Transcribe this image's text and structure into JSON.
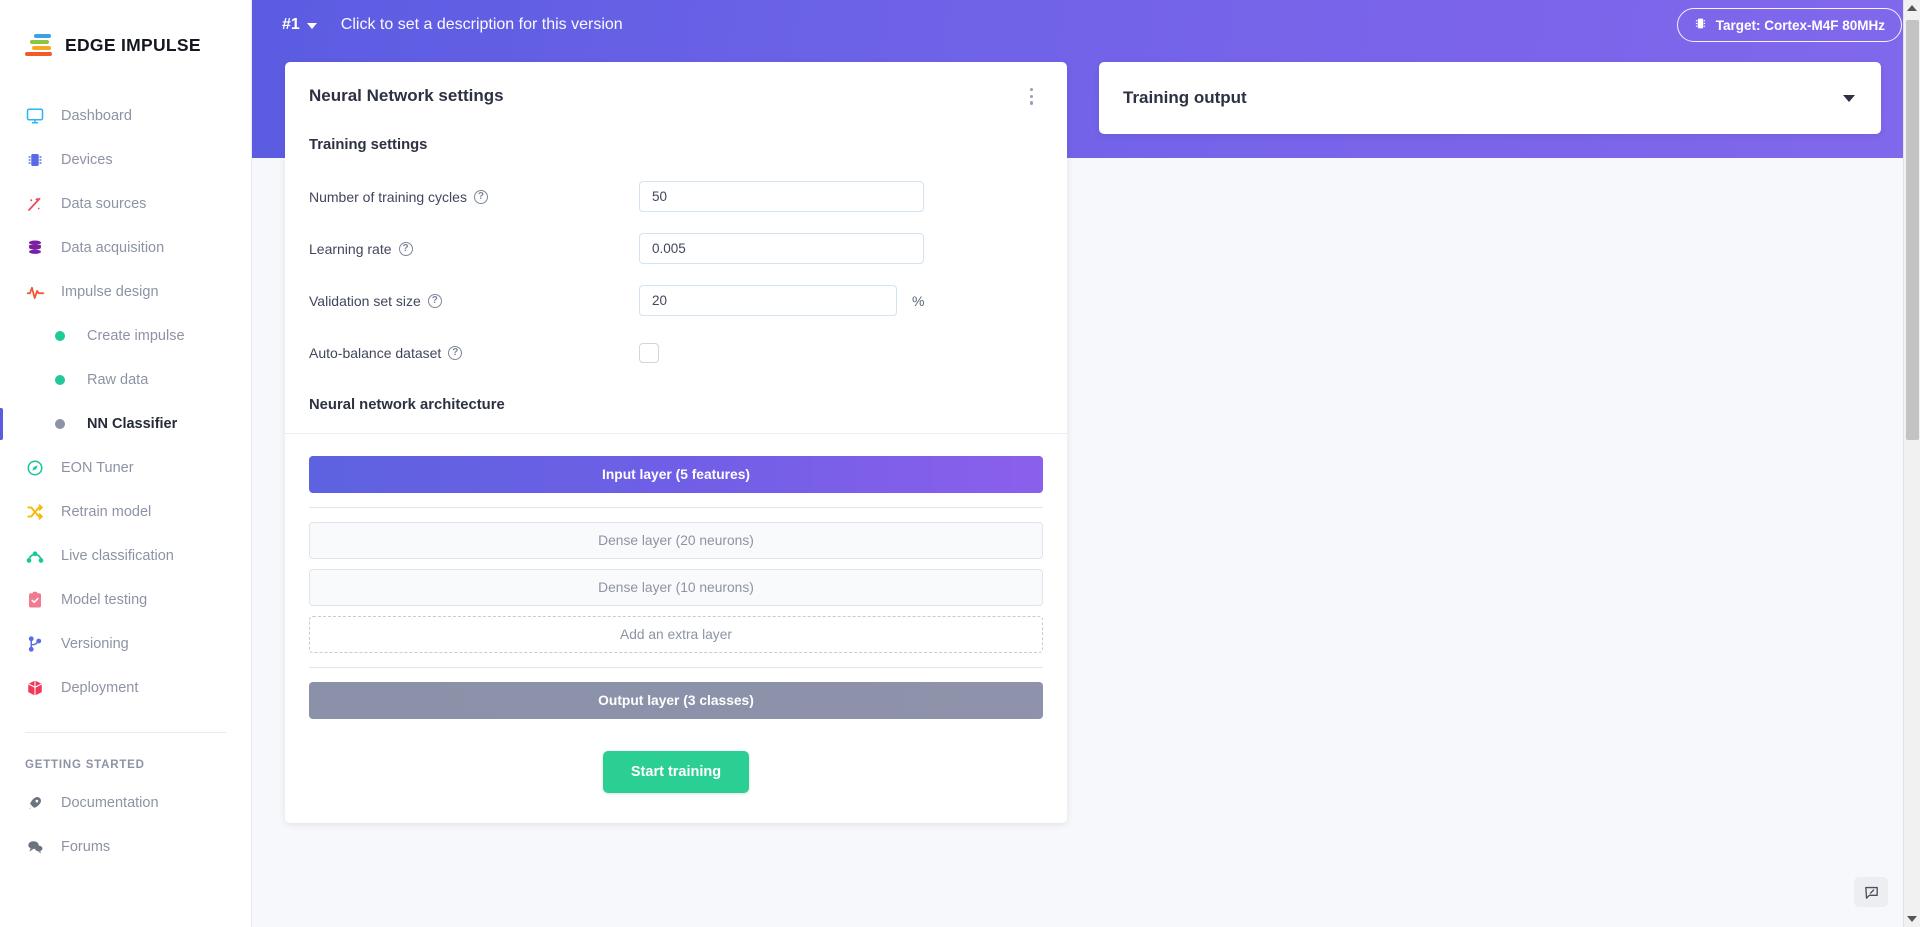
{
  "brand": {
    "name": "EDGE IMPULSE"
  },
  "banner": {
    "version": "#1",
    "description": "Click to set a description for this version",
    "target_badge": "Target: Cortex-M4F 80MHz"
  },
  "sidebar": {
    "items": [
      {
        "label": "Dashboard",
        "icon": "monitor-icon",
        "color": "#29b6f6"
      },
      {
        "label": "Devices",
        "icon": "chip-icon",
        "color": "#5b6ce2"
      },
      {
        "label": "Data sources",
        "icon": "wand-icon",
        "color": "#ef4a5e"
      },
      {
        "label": "Data acquisition",
        "icon": "database-icon",
        "color": "#7b1fa2"
      },
      {
        "label": "Impulse design",
        "icon": "pulse-icon",
        "color": "#f4542c"
      }
    ],
    "sub_items": [
      {
        "label": "Create impulse",
        "active": false
      },
      {
        "label": "Raw data",
        "active": false
      },
      {
        "label": "NN Classifier",
        "active": true
      }
    ],
    "items_after": [
      {
        "label": "EON Tuner",
        "icon": "compass-icon",
        "color": "#16c79a"
      },
      {
        "label": "Retrain model",
        "icon": "shuffle-icon",
        "color": "#f5b800"
      },
      {
        "label": "Live classification",
        "icon": "arc-icon",
        "color": "#16c79a"
      },
      {
        "label": "Model testing",
        "icon": "clipboard-check-icon",
        "color": "#f07b8e"
      },
      {
        "label": "Versioning",
        "icon": "git-branch-icon",
        "color": "#5b6ce2"
      },
      {
        "label": "Deployment",
        "icon": "box-icon",
        "color": "#f2385a"
      }
    ],
    "getting_started_header": "GETTING STARTED",
    "getting_started": [
      {
        "label": "Documentation",
        "icon": "rocket-icon",
        "color": "#6b7280"
      },
      {
        "label": "Forums",
        "icon": "chat-icon",
        "color": "#6b7280"
      }
    ]
  },
  "nn_settings": {
    "card_title": "Neural Network settings",
    "training_settings_header": "Training settings",
    "fields": [
      {
        "label": "Number of training cycles",
        "value": "50",
        "suffix": ""
      },
      {
        "label": "Learning rate",
        "value": "0.005",
        "suffix": ""
      },
      {
        "label": "Validation set size",
        "value": "20",
        "suffix": "%"
      }
    ],
    "auto_balance_label": "Auto-balance dataset",
    "auto_balance_checked": false,
    "architecture_header": "Neural network architecture",
    "layers": {
      "input": "Input layer (5 features)",
      "dense": [
        "Dense layer (20 neurons)",
        "Dense layer (10 neurons)"
      ],
      "add": "Add an extra layer",
      "output": "Output layer (3 classes)"
    },
    "start_button": "Start training"
  },
  "training_output": {
    "title": "Training output"
  },
  "colors": {
    "accent_purple": "#5b5ce2",
    "gradient_end": "#8168ec",
    "success_green": "#2bcf93",
    "input_layer_start": "#5d62e0",
    "input_layer_end": "#8b5fec",
    "output_layer": "#8e93ab"
  }
}
